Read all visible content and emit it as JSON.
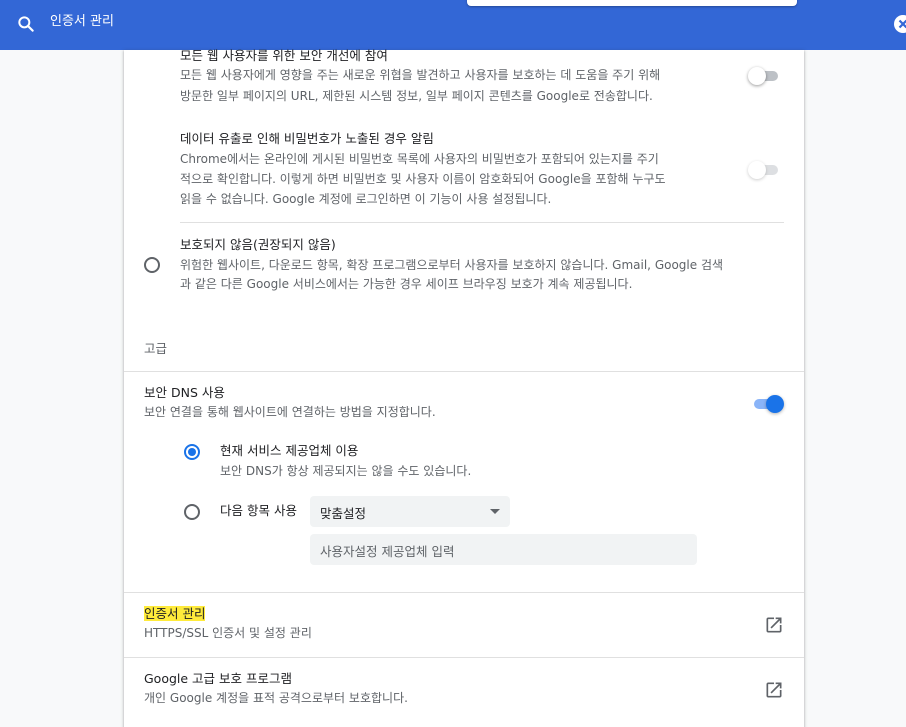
{
  "search": {
    "query": "인증서 관리",
    "icon": "search-icon",
    "clear_icon": "close-icon"
  },
  "safe_browsing": {
    "help_improve": {
      "title": "모든 웹 사용자를 위한 보안 개선에 참여",
      "desc_line1": "모든 웹 사용자에게 영향을 주는 새로운 위협을 발견하고 사용자를 보호하는 데 도움을 주기 위해",
      "desc_line2": "방문한 일부 페이지의 URL, 제한된 시스템 정보, 일부 페이지 콘텐츠를 Google로 전송합니다.",
      "enabled": false
    },
    "password_leak": {
      "title": "데이터 유출로 인해 비밀번호가 노출된 경우 알림",
      "desc_line1": "Chrome에서는 온라인에 게시된 비밀번호 목록에 사용자의 비밀번호가 포함되어 있는지를 주기",
      "desc_line2": "적으로 확인합니다. 이렇게 하면 비밀번호 및 사용자 이름이 암호화되어 Google을 포함해 누구도",
      "desc_line3": "읽을 수 없습니다. Google 계정에 로그인하면 이 기능이 사용 설정됩니다.",
      "enabled": false
    },
    "no_protection": {
      "title": "보호되지 않음(권장되지 않음)",
      "desc_line1": "위험한 웹사이트, 다운로드 항목, 확장 프로그램으로부터 사용자를 보호하지 않습니다. Gmail, Google 검색",
      "desc_line2": "과 같은 다른 Google 서비스에서는 가능한 경우 세이프 브라우징 보호가 계속 제공됩니다.",
      "selected": false
    }
  },
  "advanced": {
    "heading": "고급",
    "secure_dns": {
      "title": "보안 DNS 사용",
      "desc": "보안 연결을 통해 웹사이트에 연결하는 방법을 지정합니다.",
      "enabled": true,
      "current_provider": {
        "title": "현재 서비스 제공업체 이용",
        "desc": "보안 DNS가 항상 제공되지는 않을 수도 있습니다.",
        "selected": true
      },
      "custom": {
        "label": "다음 항목 사용",
        "selected": false,
        "select_value": "맞춤설정",
        "input_placeholder": "사용자설정 제공업체 입력"
      }
    },
    "manage_certificates": {
      "title": "인증서 관리",
      "desc": "HTTPS/SSL 인증서 및 설정 관리",
      "icon": "open-in-new-icon"
    },
    "advanced_protection": {
      "title": "Google 고급 보호 프로그램",
      "desc": "개인 Google 계정을 표적 공격으로부터 보호합니다.",
      "icon": "open-in-new-icon"
    }
  },
  "colors": {
    "header": "#3367d6",
    "accent": "#1a73e8",
    "highlight": "#ffeb3b"
  }
}
